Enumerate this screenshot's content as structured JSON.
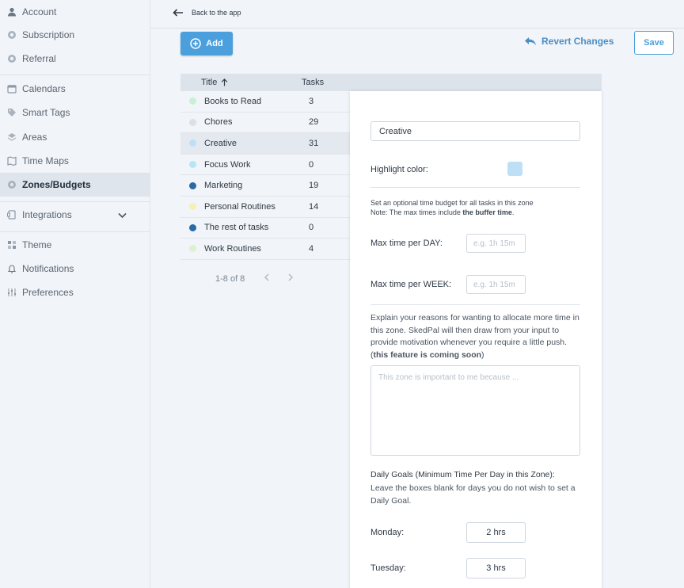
{
  "sidebar": {
    "items": [
      {
        "label": "Account",
        "icon": "person-icon"
      },
      {
        "label": "Subscription",
        "icon": "subscription-icon"
      },
      {
        "label": "Referral",
        "icon": "referral-icon"
      },
      {
        "label": "Calendars",
        "icon": "calendar-icon"
      },
      {
        "label": "Smart Tags",
        "icon": "tag-icon"
      },
      {
        "label": "Areas",
        "icon": "layers-icon"
      },
      {
        "label": "Time Maps",
        "icon": "map-icon"
      },
      {
        "label": "Zones/Budgets",
        "icon": "zones-icon"
      },
      {
        "label": "Integrations",
        "icon": "puzzle-icon"
      },
      {
        "label": "Theme",
        "icon": "theme-icon"
      },
      {
        "label": "Notifications",
        "icon": "bell-icon"
      },
      {
        "label": "Preferences",
        "icon": "sliders-icon"
      }
    ]
  },
  "topbar": {
    "back_label": "Back to the app"
  },
  "toolbar": {
    "add_label": "Add",
    "revert_label": "Revert Changes",
    "save_label": "Save"
  },
  "table": {
    "headers": {
      "title": "Title",
      "tasks": "Tasks"
    },
    "rows": [
      {
        "name": "Books to Read",
        "count": "3",
        "color": "#c9efd6"
      },
      {
        "name": "Chores",
        "count": "29",
        "color": "#d9e0e8"
      },
      {
        "name": "Creative",
        "count": "31",
        "color": "#bde0f7"
      },
      {
        "name": "Focus Work",
        "count": "0",
        "color": "#b5e6f5"
      },
      {
        "name": "Marketing",
        "count": "19",
        "color": "#2a6aa5"
      },
      {
        "name": "Personal Routines",
        "count": "14",
        "color": "#f6f0b8"
      },
      {
        "name": "The rest of tasks",
        "count": "0",
        "color": "#2a6aa5"
      },
      {
        "name": "Work Routines",
        "count": "4",
        "color": "#dcf2cf"
      }
    ],
    "pager": "1-8 of 8"
  },
  "panel": {
    "zone_name": "Creative",
    "highlight_label": "Highlight color:",
    "highlight_color": "#bde0f7",
    "budget_note_1": "Set an optional time budget for all tasks in this zone",
    "budget_note_2_prefix": "Note: The max times include ",
    "budget_note_2_bold": "the buffer time",
    "budget_note_2_suffix": ".",
    "max_day_label": "Max time per DAY:",
    "max_day_placeholder": "e.g. 1h 15m",
    "max_week_label": "Max time per WEEK:",
    "max_week_placeholder": "e.g. 1h 15m",
    "reasons_text": "Explain your reasons for wanting to allocate more time in this zone. SkedPal will then draw from your input to provide motivation whenever you require a little push. (",
    "reasons_bold": "this feature is coming soon",
    "reasons_end": ")",
    "reasons_placeholder": "This zone is important to me because ...",
    "daily_goals_title": "Daily Goals (Minimum Time Per Day in this Zone):",
    "daily_goals_hint": "Leave the boxes blank for days you do not wish to set a Daily Goal.",
    "monday_label": "Monday:",
    "monday_value": "2 hrs",
    "tuesday_label": "Tuesday:",
    "tuesday_value": "3 hrs"
  }
}
